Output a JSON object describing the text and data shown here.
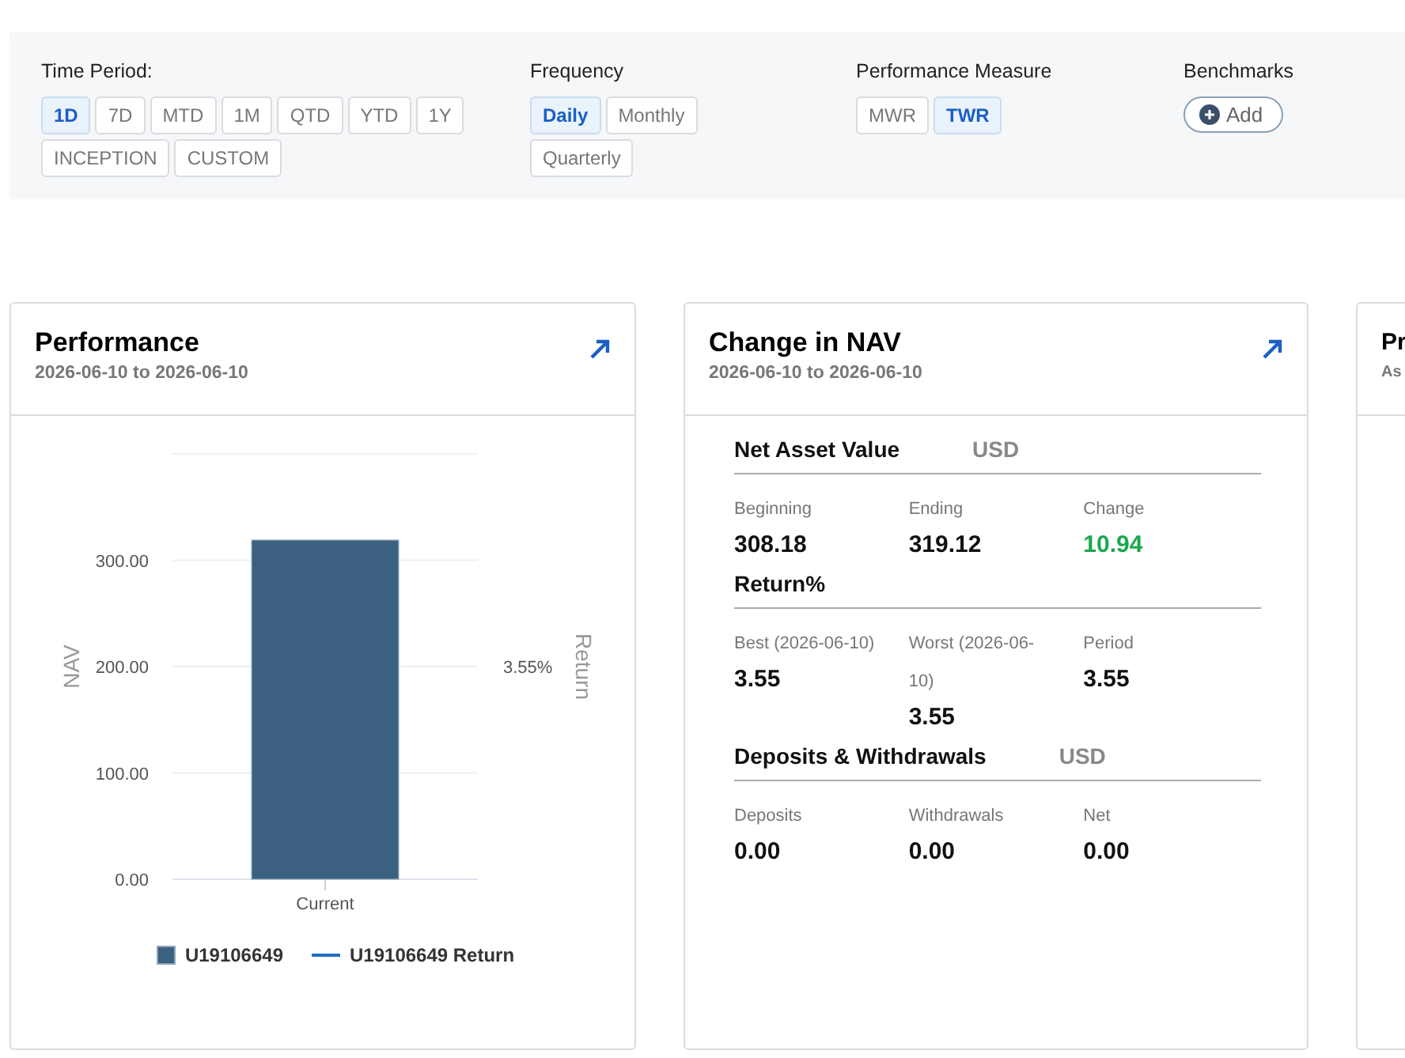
{
  "filters": [
    {
      "label": "Time Period:",
      "options": [
        {
          "label": "1D",
          "selected": true
        },
        {
          "label": "7D",
          "selected": false
        },
        {
          "label": "MTD",
          "selected": false
        },
        {
          "label": "1M",
          "selected": false
        },
        {
          "label": "QTD",
          "selected": false
        },
        {
          "label": "YTD",
          "selected": false
        },
        {
          "label": "1Y",
          "selected": false
        },
        {
          "label": "INCEPTION",
          "selected": false
        },
        {
          "label": "CUSTOM",
          "selected": false
        }
      ]
    },
    {
      "label": "Frequency",
      "options": [
        {
          "label": "Daily",
          "selected": true
        },
        {
          "label": "Monthly",
          "selected": false
        },
        {
          "label": "Quarterly",
          "selected": false
        }
      ]
    },
    {
      "label": "Performance Measure",
      "options": [
        {
          "label": "MWR",
          "selected": false
        },
        {
          "label": "TWR",
          "selected": true
        }
      ]
    }
  ],
  "benchmarks": {
    "label": "Benchmarks",
    "button": "Add"
  },
  "performance": {
    "title": "Performance",
    "subtitle": "2026-06-10 to 2026-06-10",
    "chart_data": {
      "type": "bar",
      "ylabel": "NAV",
      "categories": [
        "Current"
      ],
      "series": [
        {
          "name": "U19106649",
          "color": "#3c6180",
          "values": [
            319
          ]
        }
      ],
      "ylim": [
        0,
        400
      ],
      "grid": true,
      "yticks": [
        {
          "value": 0,
          "label": "0.00"
        },
        {
          "value": 100,
          "label": "100.00"
        },
        {
          "value": 200,
          "label": "200.00"
        },
        {
          "value": 300,
          "label": "300.00"
        }
      ]
    },
    "right_axis": {
      "label": "Return",
      "tick": "3.55%"
    },
    "legend": [
      {
        "kind": "swatch"
      },
      {
        "kind": "line",
        "label": "U19106649 Return"
      }
    ]
  },
  "change_in_nav": {
    "title": "Change in NAV",
    "subtitle": "2026-06-10 to 2026-06-10",
    "sections": [
      {
        "title": "Net Asset Value",
        "currency": "USD",
        "items": [
          {
            "label": "Beginning",
            "value": "308.18",
            "positive": false
          },
          {
            "label": "Ending",
            "value": "319.12",
            "positive": false
          },
          {
            "label": "Change",
            "value": "10.94",
            "positive": true
          }
        ]
      },
      {
        "title": "Return%",
        "items": [
          {
            "label": "Best (2026-06-10)",
            "value": "3.55",
            "positive": false
          },
          {
            "label": "Worst (2026-06-10)",
            "value": "3.55",
            "positive": false
          },
          {
            "label": "Period",
            "value": "3.55",
            "positive": false
          }
        ]
      },
      {
        "title": "Deposits & Withdrawals",
        "currency": "USD",
        "items": [
          {
            "label": "Deposits",
            "value": "0.00",
            "positive": false
          },
          {
            "label": "Withdrawals",
            "value": "0.00",
            "positive": false
          },
          {
            "label": "Net",
            "value": "0.00",
            "positive": false
          }
        ]
      }
    ]
  },
  "third_card": {
    "title": "Pr",
    "subtitle": "As"
  }
}
